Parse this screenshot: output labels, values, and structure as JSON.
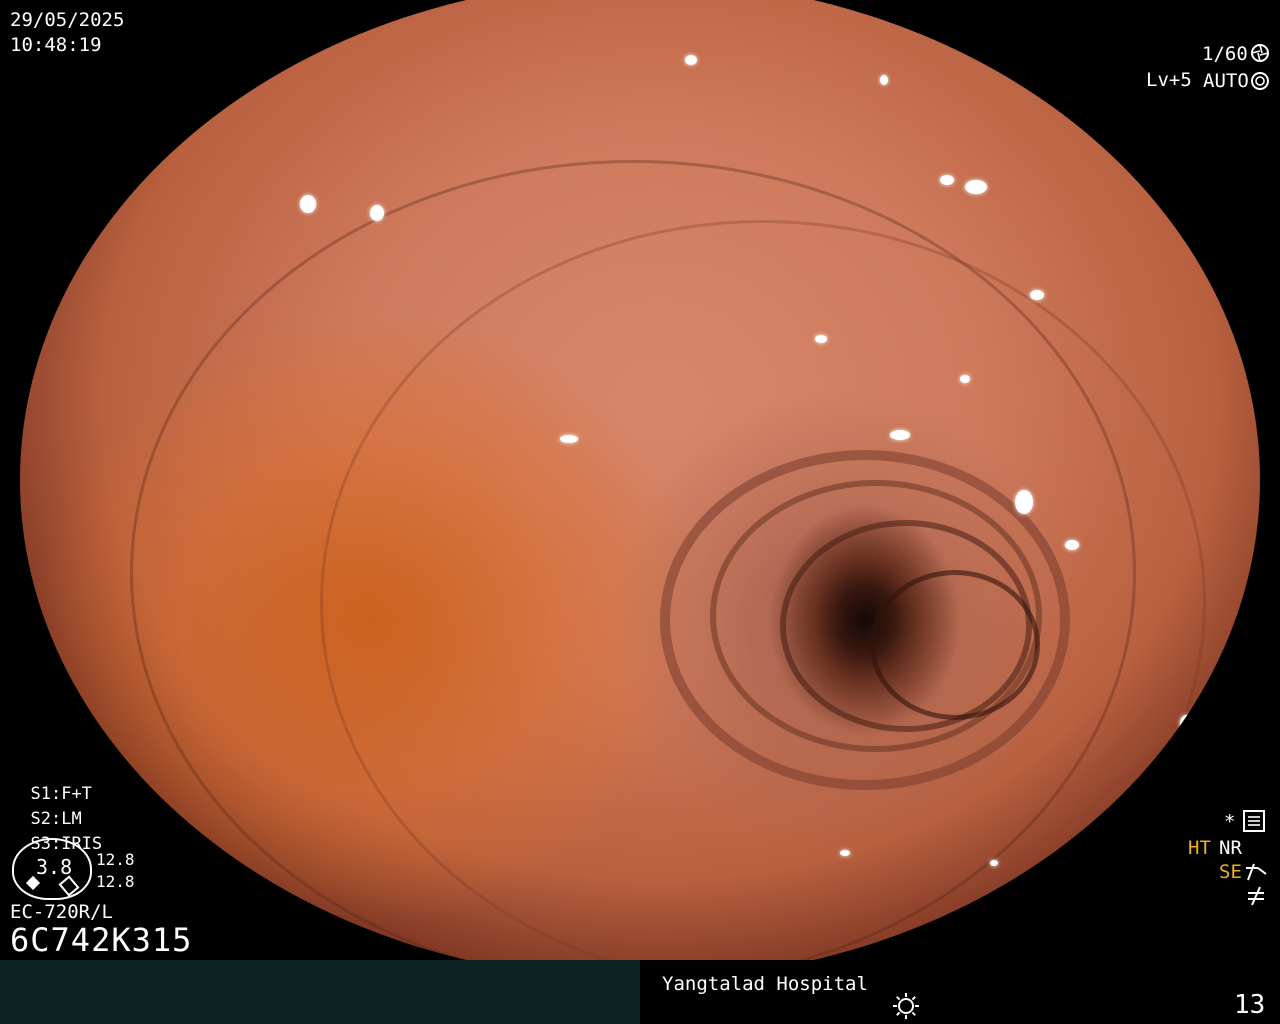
{
  "osd": {
    "date": "29/05/2025",
    "time": "10:48:19",
    "shutter": "1/60",
    "level": "Lv+5",
    "exposure_mode": "AUTO",
    "s1_label": "S1:",
    "s1_value": "F+T",
    "s2_label": "S2:",
    "s2_value": "LM",
    "s3_label": "S3:",
    "s3_value": "IRIS",
    "gauge_value": "3.8",
    "gauge_top": "12.8",
    "gauge_bottom": "12.8",
    "scope_model": "EC-720R/L",
    "serial": "6C742K315",
    "ht": "HT",
    "nr": "NR",
    "se": "SE",
    "asterisk": "*"
  },
  "footer": {
    "hospital": "Yangtalad Hospital",
    "frame_number": "13"
  },
  "colors": {
    "accent_yellow": "#f0b020",
    "footer_bar": "#0e2423"
  },
  "icons": [
    "shutter-icon",
    "auto-exposure-icon",
    "settings-menu-icon",
    "enhance-icon",
    "no-signal-icon",
    "brightness-icon"
  ]
}
